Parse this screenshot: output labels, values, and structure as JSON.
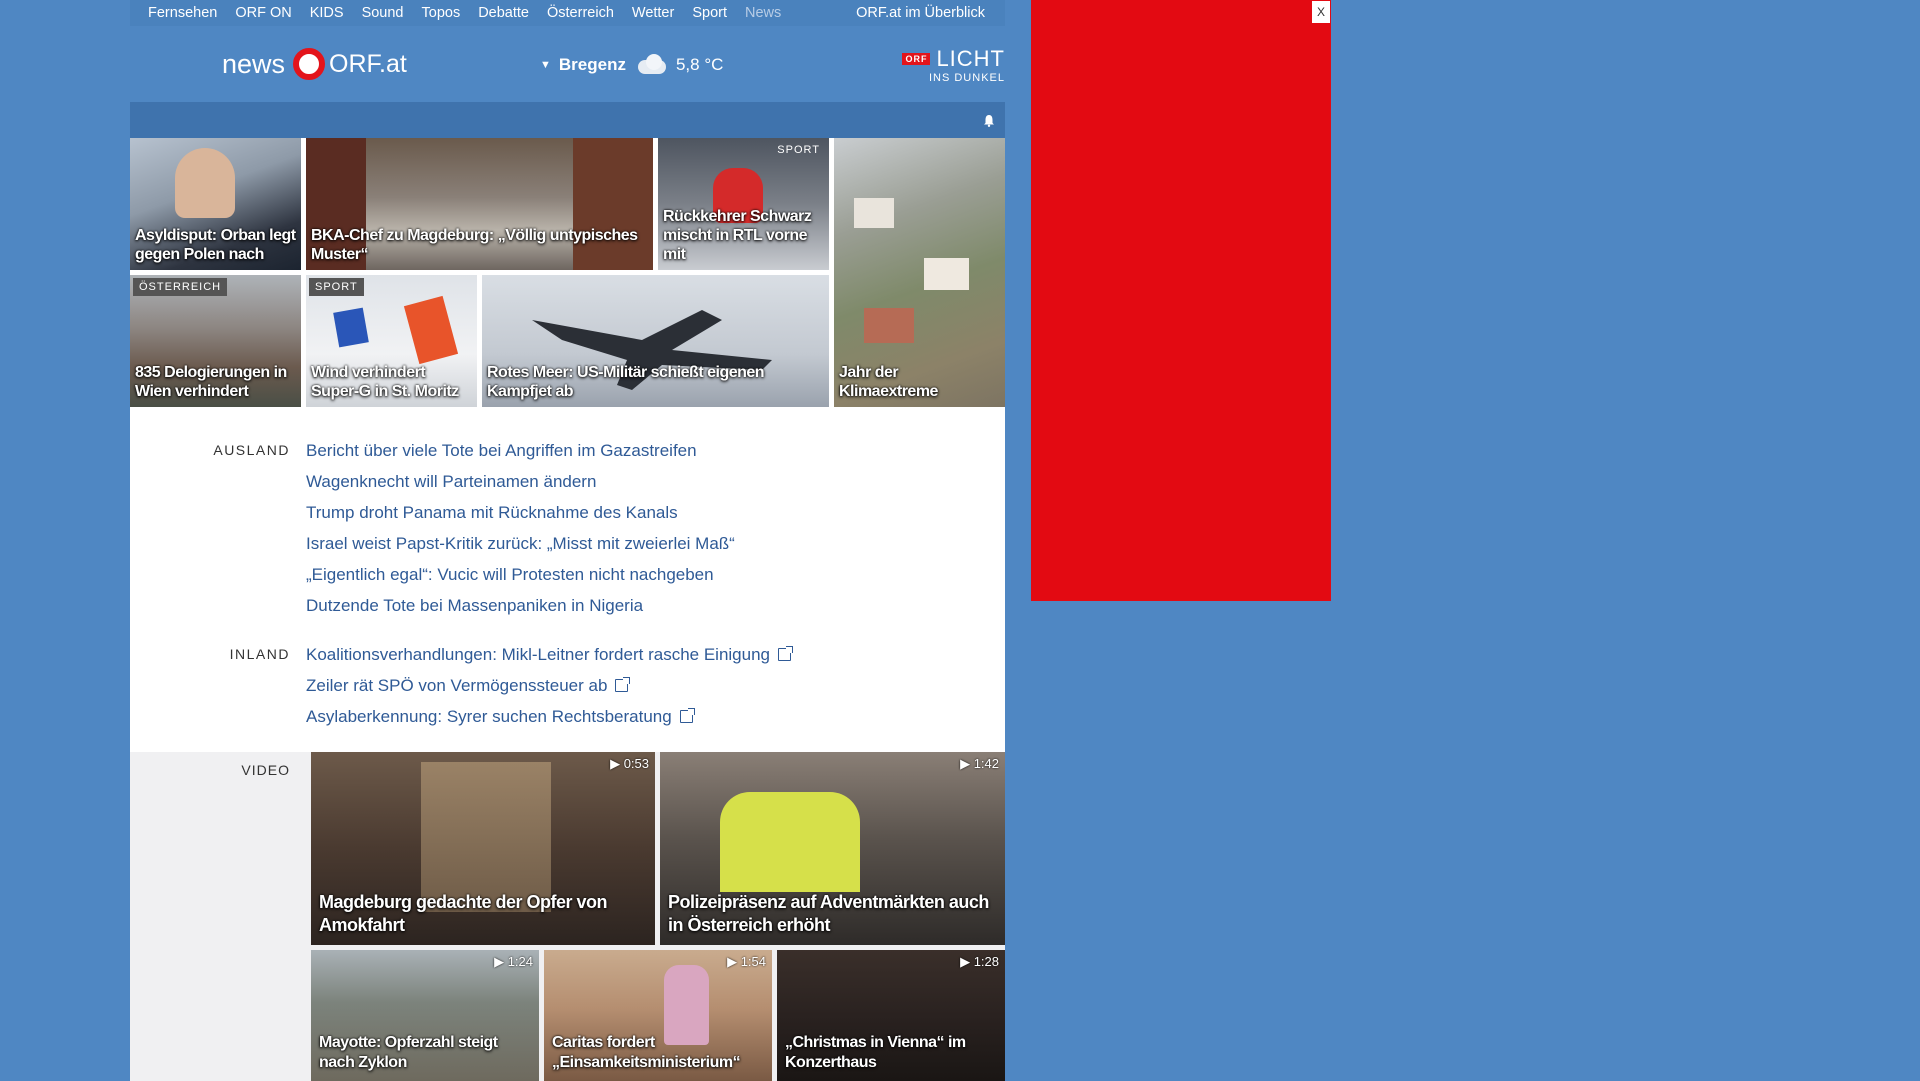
{
  "topnav": {
    "items": [
      "Fernsehen",
      "ORF ON",
      "KIDS",
      "Sound",
      "Topos",
      "Debatte",
      "Österreich",
      "Wetter",
      "Sport",
      "News"
    ],
    "overview": "ORF.at im Überblick"
  },
  "header": {
    "logo_news": "news",
    "logo_orf": "ORF.at",
    "location": "Bregenz",
    "temperature": "5,8 °C",
    "licht_badge": "ORF",
    "licht_title": "LICHT",
    "licht_sub": "INS DUNKEL"
  },
  "tiles": [
    {
      "caption": "Asyldisput: Orban legt gegen Polen nach",
      "tag": ""
    },
    {
      "caption": "BKA-Chef zu Magdeburg: „Völlig untypisches Muster“",
      "tag": ""
    },
    {
      "caption": "Rückkehrer Schwarz mischt in RTL vorne mit",
      "tag": "SPORT"
    },
    {
      "caption": "Jahr der Klimaextreme",
      "tag": ""
    },
    {
      "caption": "835 Delogierungen in Wien verhindert",
      "tag": "ÖSTERREICH"
    },
    {
      "caption": "Wind verhindert Super-G in St. Moritz",
      "tag": "SPORT"
    },
    {
      "caption": "Rotes Meer: US-Militär schießt eigenen Kampfjet ab",
      "tag": ""
    }
  ],
  "ausland": {
    "label": "AUSLAND",
    "items": [
      "Bericht über viele Tote bei Angriffen im Gazastreifen",
      "Wagenknecht will Parteinamen ändern",
      "Trump droht Panama mit Rücknahme des Kanals",
      "Israel weist Papst-Kritik zurück: „Misst mit zweierlei Maß“",
      "„Eigentlich egal“: Vucic will Protesten nicht nachgeben",
      "Dutzende Tote bei Massenpaniken in Nigeria"
    ]
  },
  "inland": {
    "label": "INLAND",
    "items": [
      "Koalitionsverhandlungen: Mikl-Leitner fordert rasche Einigung",
      "Zeiler rät SPÖ von Vermögenssteuer ab",
      "Asylaberkennung: Syrer suchen Rechtsberatung"
    ]
  },
  "video": {
    "label": "VIDEO",
    "items": [
      {
        "caption": "Magdeburg gedachte der Opfer von Amokfahrt",
        "duration": "▶ 0:53"
      },
      {
        "caption": "Polizeipräsenz auf Adventmärkten auch in Österreich erhöht",
        "duration": "▶ 1:42"
      },
      {
        "caption": "Mayotte: Opferzahl steigt nach Zyklon",
        "duration": "▶ 1:24"
      },
      {
        "caption": "Caritas fordert „Einsamkeitsministerium“",
        "duration": "▶ 1:54"
      },
      {
        "caption": "„Christmas in Vienna“ im Konzerthaus",
        "duration": "▶ 1:28"
      }
    ]
  },
  "ad": {
    "close": "X"
  }
}
